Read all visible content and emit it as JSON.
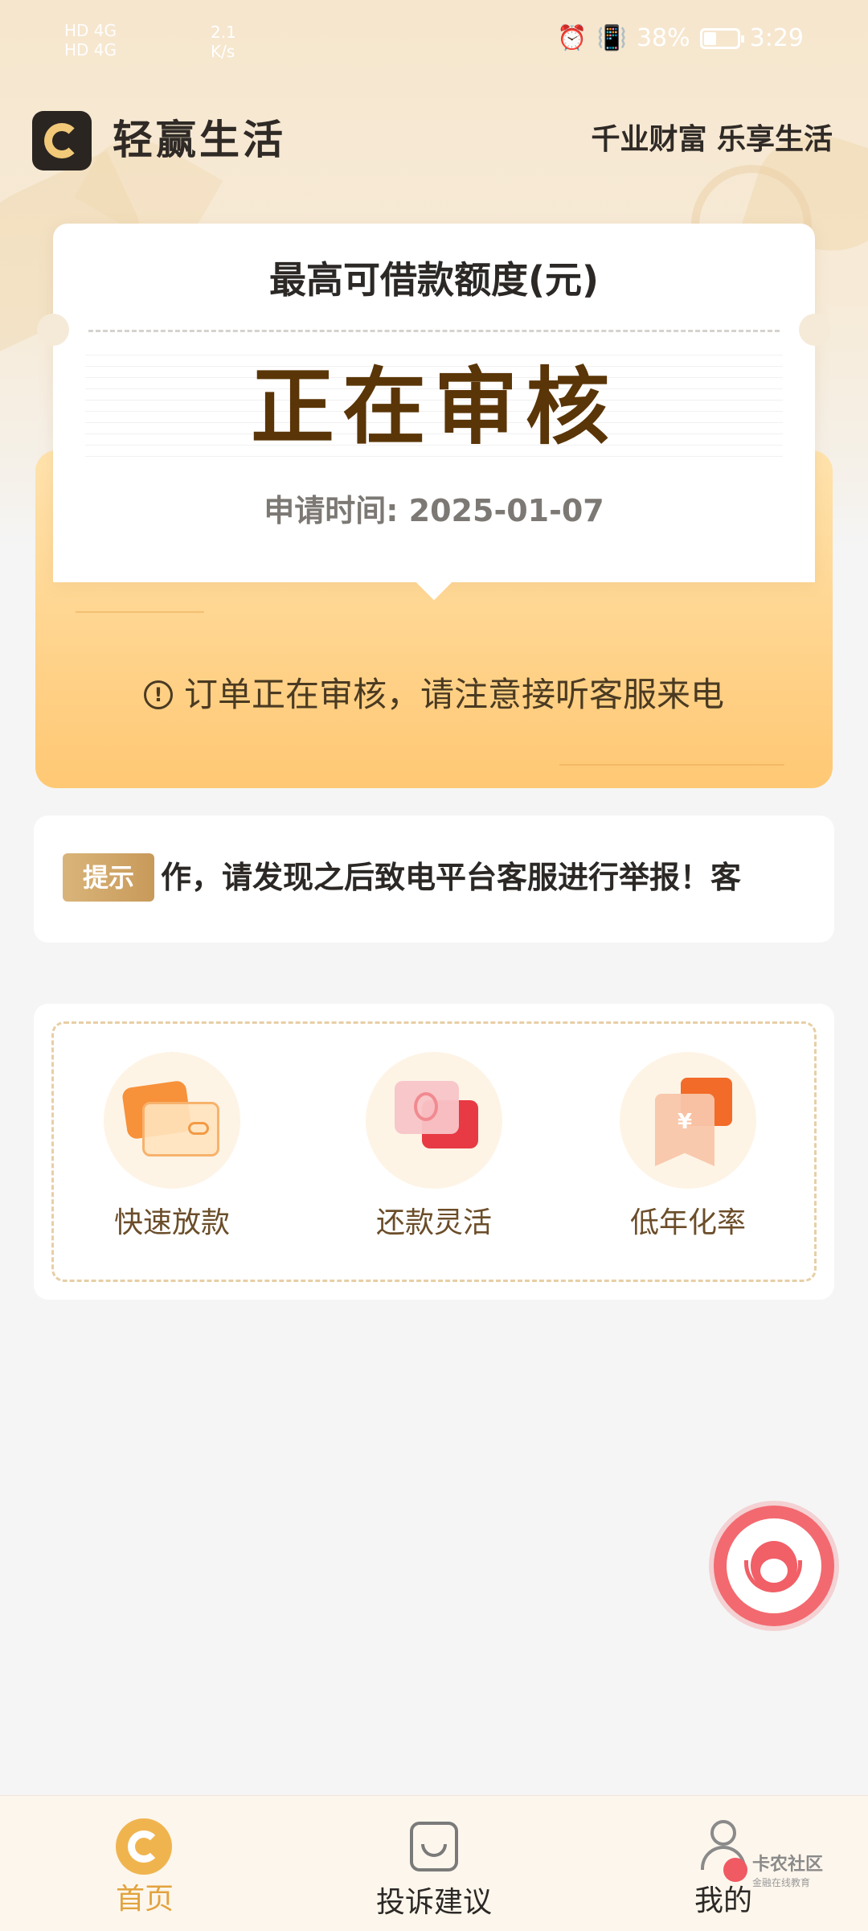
{
  "status_bar": {
    "network_1": "HD 4G",
    "network_2": "HD 4G",
    "speed_value": "2.1",
    "speed_unit": "K/s",
    "battery": "38%",
    "battery_level": 0.38,
    "time": "3:29",
    "icons": [
      "alarm-icon",
      "vibrate-icon",
      "battery-icon"
    ]
  },
  "header": {
    "app_name": "轻赢生活",
    "slogan": "千业财富 乐享生活"
  },
  "limit_card": {
    "label": "最高可借款额度(元)",
    "status": "正在审核",
    "apply_time": "申请时间: 2025-01-07",
    "notice": "订单正在审核，请注意接听客服来电",
    "notice_icon": "!"
  },
  "tip": {
    "badge": "提示",
    "text": "作，请发现之后致电平台客服进行举报！客"
  },
  "features": [
    {
      "label": "快速放款",
      "icon": "wallet-icon"
    },
    {
      "label": "还款灵活",
      "icon": "chat-coins-icon"
    },
    {
      "label": "低年化率",
      "icon": "money-bag-icon"
    }
  ],
  "bottom_nav": [
    {
      "label": "首页",
      "icon": "home-icon",
      "active": true
    },
    {
      "label": "投诉建议",
      "icon": "complaint-icon",
      "active": false
    },
    {
      "label": "我的",
      "icon": "user-icon",
      "active": false
    }
  ],
  "watermark": {
    "title": "卡农社区",
    "subtitle": "金融在线教育"
  },
  "colors": {
    "accent": "#e2a33d",
    "status_text": "#5a3507",
    "fab": "#f36970"
  }
}
